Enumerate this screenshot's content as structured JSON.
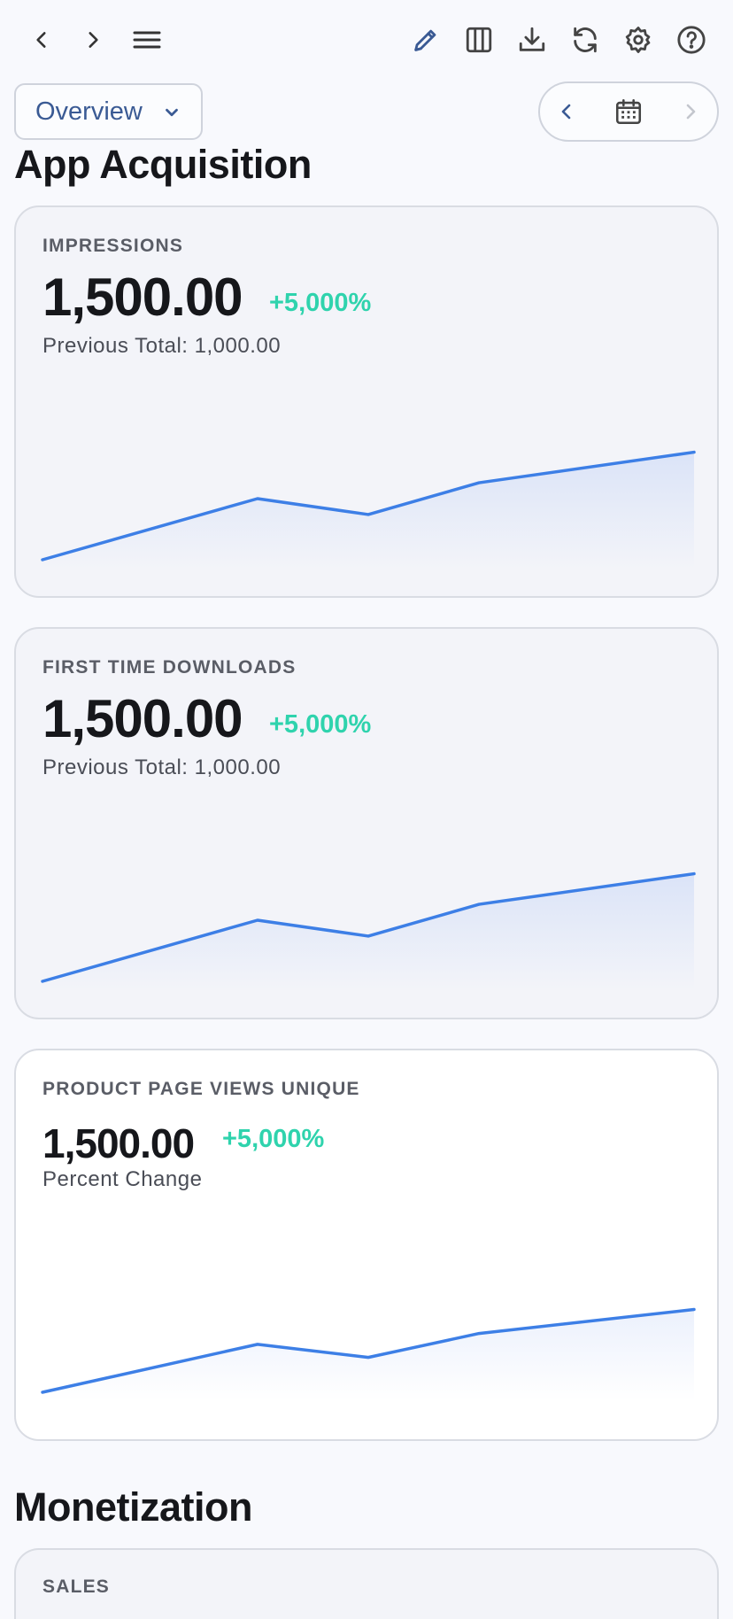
{
  "toolbar": {
    "icons": [
      "chevron-left-icon",
      "chevron-right-icon",
      "menu-icon",
      "pencil-icon",
      "columns-icon",
      "download-icon",
      "refresh-icon",
      "gear-icon",
      "help-icon"
    ]
  },
  "view_select": {
    "label": "Overview"
  },
  "colors": {
    "accent": "#3a5a94",
    "line": "#3d7fe6",
    "positive": "#2fd3ad",
    "background": "#f8f9fd"
  },
  "sections": [
    {
      "title": "App Acquisition",
      "cards": [
        {
          "label": "IMPRESSIONS",
          "value": "1,500.00",
          "change": "+5,000%",
          "sub": "Previous Total: 1,000.00",
          "trend": [
            0.0,
            0.5,
            0.37,
            0.63,
            0.88
          ]
        },
        {
          "label": "FIRST TIME DOWNLOADS",
          "value": "1,500.00",
          "change": "+5,000%",
          "sub": "Previous Total: 1,000.00",
          "trend": [
            0.0,
            0.5,
            0.37,
            0.63,
            0.88
          ]
        },
        {
          "label": "PRODUCT PAGE VIEWS UNIQUE",
          "value": "1,500.00",
          "change": "+5,000%",
          "sub": "Percent Change",
          "trend": [
            0.0,
            0.22,
            0.16,
            0.27,
            0.38
          ]
        }
      ]
    },
    {
      "title": "Monetization",
      "cards": [
        {
          "label": "SALES"
        }
      ]
    }
  ]
}
